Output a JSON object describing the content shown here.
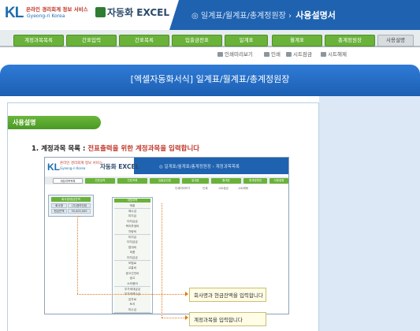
{
  "header": {
    "logo": "KL",
    "logo_sub": "온라인 경리회계 정보 서비스",
    "logo_sub2": "Gyeong-ri Korea",
    "product": "자동화 EXCEL",
    "breadcrumb": "◎ 일계표/월계표/총계정원장 ›",
    "breadcrumb_current": "사용설명서"
  },
  "nav": {
    "tabs": [
      "계정과목목록",
      "간표입력",
      "간표목록",
      "입출금전표",
      "일계표",
      "월계표",
      "총계정원장",
      "사용설명"
    ],
    "active_index": 7
  },
  "toolbar": {
    "print_preview": "인쇄미리보기",
    "print": "인쇄",
    "sheet_protect": "시트잠금",
    "sheet_unprotect": "시트해제"
  },
  "page": {
    "title": "[엑셀자동화서식] 일계표/월계표/총계정원장",
    "guide_label": "사용설명",
    "step_title": "1. 계정과목 목록 : ",
    "step_desc": "전표출력을 위한 계정과목을 입력합니다"
  },
  "screenshot": {
    "logo": "KL",
    "logo_sub": "온라인 경리회계 정보 서비스",
    "logo_sub2": "Gyeong-ri Korea",
    "product": "자동화 EXCEL",
    "breadcrumb": "◎ 일계표/월계표/총계정원장 › 계정과목목록",
    "tabs": [
      "계정과목목록",
      "간표입력",
      "간표목록",
      "입출금전표",
      "일계표",
      "월계표",
      "총계정원장",
      "사용설명"
    ],
    "active_index": 0,
    "toolbar": [
      "인쇄미리보기",
      "인쇄",
      "시트잠금",
      "시트해제"
    ],
    "info_table": {
      "header": "회사명/현금잔액",
      "rows": [
        {
          "label": "회사명",
          "value": "(주)경리닷컴"
        },
        {
          "label": "현금잔액",
          "value": "35,000,000"
        }
      ]
    },
    "account_header": "계정과목",
    "accounts": [
      "매출",
      "매수금",
      "미지급",
      "미지급금",
      "복리후생비",
      "차량비",
      "미지급",
      "미지급금",
      "접대비",
      "비품",
      "미지급금",
      "보험료",
      "교통비",
      "광고선전비",
      "광고",
      "소모품비",
      "부가세대급금",
      "부가세예수금",
      "임차료",
      "토지",
      "미수금"
    ]
  },
  "callouts": {
    "company_cash": "회사명과 현금잔액을 입력합니다",
    "accounts": "계정과목을 입력합니다"
  }
}
